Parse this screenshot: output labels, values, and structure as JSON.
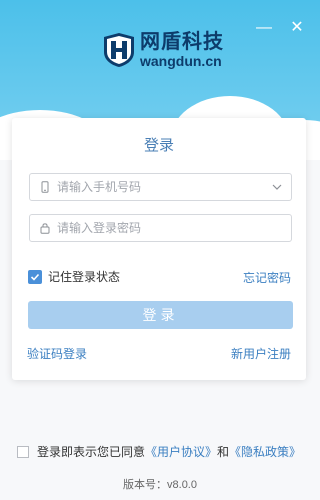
{
  "window": {
    "minimize_label": "—",
    "close_label": "✕"
  },
  "brand": {
    "name_cn": "网盾科技",
    "domain": "wangdun.cn",
    "logo_letter": "H"
  },
  "login": {
    "title": "登录",
    "phone_placeholder": "请输入手机号码",
    "password_placeholder": "请输入登录密码",
    "remember_label": "记住登录状态",
    "remember_checked": true,
    "forgot_label": "忘记密码",
    "submit_label": "登录",
    "sms_login_label": "验证码登录",
    "register_label": "新用户注册"
  },
  "agreement": {
    "prefix": "登录即表示您已同意",
    "user_agreement": "《用户协议》",
    "and": "和",
    "privacy_policy": "《隐私政策》",
    "checked": false
  },
  "version_text": "版本号：v8.0.0",
  "colors": {
    "header_top": "#4cc0ea",
    "accent_link": "#3b7fc1",
    "submit_disabled": "#a8ceef",
    "checkbox": "#4a90d9"
  },
  "icons": [
    "phone-icon",
    "chevron-down-icon",
    "lock-icon",
    "check-icon",
    "minimize-icon",
    "close-icon"
  ]
}
